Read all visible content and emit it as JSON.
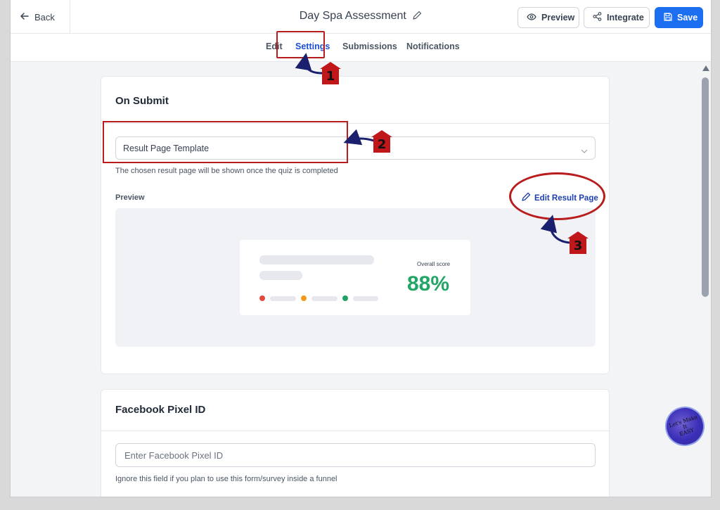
{
  "header": {
    "back_label": "Back",
    "title": "Day Spa Assessment",
    "preview_label": "Preview",
    "integrate_label": "Integrate",
    "save_label": "Save"
  },
  "tabs": [
    {
      "label": "Edit"
    },
    {
      "label": "Settings",
      "active": true
    },
    {
      "label": "Submissions"
    },
    {
      "label": "Notifications"
    }
  ],
  "on_submit": {
    "title": "On Submit",
    "select_value": "Result Page Template",
    "helper": "The chosen result page will be shown once the quiz is completed",
    "preview_label": "Preview",
    "edit_link": "Edit Result Page",
    "preview_card": {
      "overall_label": "Overall score",
      "score": "88%"
    }
  },
  "facebook_pixel": {
    "title": "Facebook Pixel ID",
    "placeholder": "Enter Facebook Pixel ID",
    "helper": "Ignore this field if you plan to use this form/survey inside a funnel"
  },
  "annotations": {
    "badge_1": "1",
    "badge_2": "2",
    "badge_3": "3"
  },
  "watermark": {
    "line1": "Let's Make",
    "line2": "It",
    "line3": "EASY"
  },
  "colors": {
    "accent": "#1d6ff2",
    "score_green": "#22a565",
    "annotation_red": "#b91c1c",
    "dot_red": "#e04a3f",
    "dot_orange": "#ef9a1a",
    "dot_green": "#1ea363"
  }
}
